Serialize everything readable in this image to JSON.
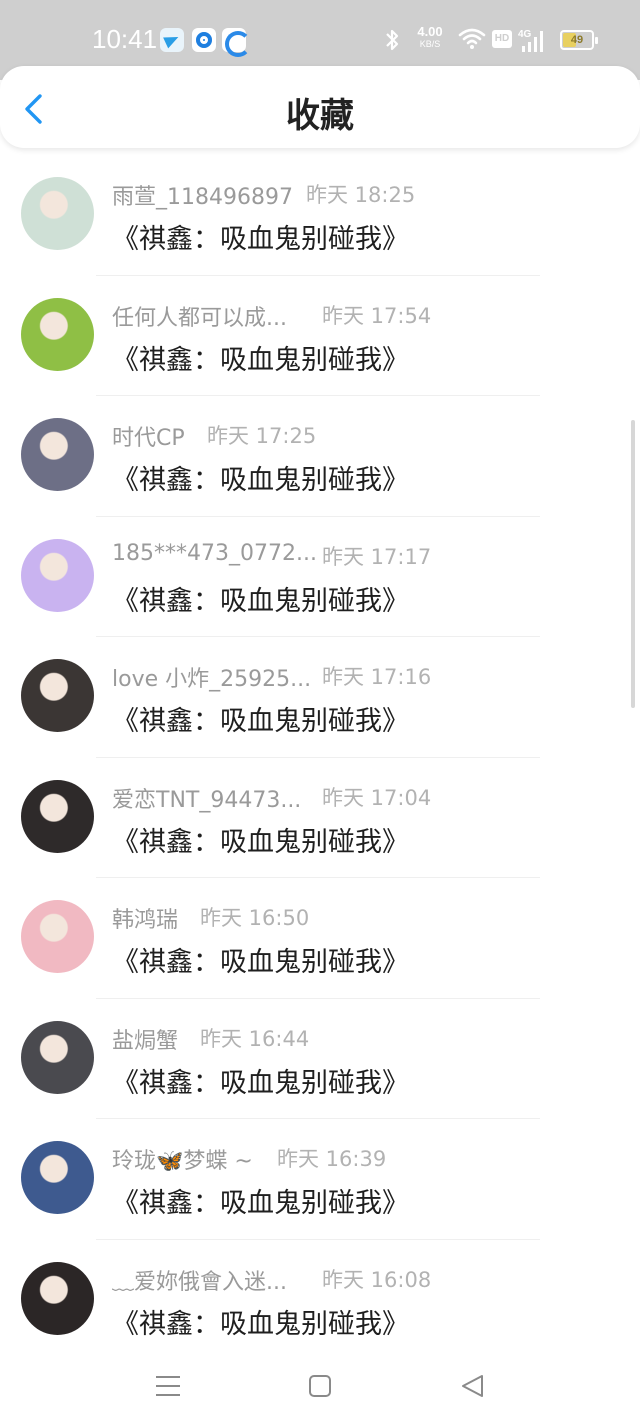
{
  "status_bar": {
    "time": "10:41",
    "net_speed_value": "4.00",
    "net_speed_unit": "KB/S",
    "hd_label": "HD",
    "battery_level": 49,
    "battery_text": "49",
    "icons": [
      "telegram-icon",
      "app-o-icon",
      "app-c-icon",
      "bluetooth-icon",
      "wifi-icon",
      "hd-icon",
      "signal-4g-icon",
      "battery-icon"
    ]
  },
  "header": {
    "title": "收藏",
    "back_icon": "chevron-left-icon",
    "accent_color": "#2196f3"
  },
  "list": {
    "items": [
      {
        "name": "雨萱_118496897",
        "time": "昨天 18:25",
        "title": "《祺鑫：吸血鬼别碰我》",
        "avatar_color": "#cfe0d6"
      },
      {
        "name": "任何人都可以成...",
        "time": "昨天 17:54",
        "title": "《祺鑫：吸血鬼别碰我》",
        "avatar_color": "#8fbf45"
      },
      {
        "name": "时代CP",
        "time": "昨天 17:25",
        "title": "《祺鑫：吸血鬼别碰我》",
        "avatar_color": "#6d6f86"
      },
      {
        "name": "185***473_0772...",
        "time": "昨天 17:17",
        "title": "《祺鑫：吸血鬼别碰我》",
        "avatar_color": "#c9b3f0"
      },
      {
        "name": "love 小炸_25925...",
        "time": "昨天 17:16",
        "title": "《祺鑫：吸血鬼别碰我》",
        "avatar_color": "#3b3634"
      },
      {
        "name": "爱恋TNT_94473...",
        "time": "昨天 17:04",
        "title": "《祺鑫：吸血鬼别碰我》",
        "avatar_color": "#2e2a2a"
      },
      {
        "name": "韩鸿瑞",
        "time": "昨天 16:50",
        "title": "《祺鑫：吸血鬼别碰我》",
        "avatar_color": "#f1b9c2"
      },
      {
        "name": "盐焗蟹",
        "time": "昨天 16:44",
        "title": "《祺鑫：吸血鬼别碰我》",
        "avatar_color": "#4a4a4f"
      },
      {
        "name": "玲珑🦋梦蝶 ~",
        "time": "昨天 16:39",
        "title": "《祺鑫：吸血鬼别碰我》",
        "avatar_color": "#3e5a8f"
      },
      {
        "name": "﹏爱妳俄會入迷...",
        "time": "昨天 16:08",
        "title": "《祺鑫：吸血鬼别碰我》",
        "avatar_color": "#2b2626"
      }
    ]
  },
  "nav_bar": {
    "icons": [
      "menu-icon",
      "home-square-icon",
      "back-triangle-icon"
    ]
  }
}
